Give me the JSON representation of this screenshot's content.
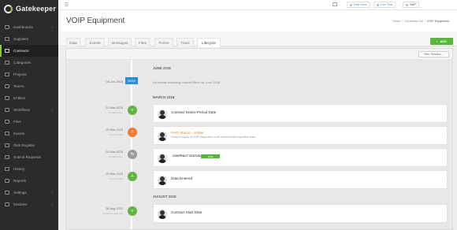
{
  "app": {
    "name": "Gatekeeper"
  },
  "sidebar": {
    "items": [
      {
        "label": "Dashboards",
        "arrow": true
      },
      {
        "label": "Suppliers",
        "arrow": false
      },
      {
        "label": "Contracts",
        "arrow": false,
        "active": true
      },
      {
        "label": "Categories",
        "arrow": false
      },
      {
        "label": "Projects",
        "arrow": false
      },
      {
        "label": "Teams",
        "arrow": false
      },
      {
        "label": "Entities",
        "arrow": false
      },
      {
        "label": "Workflows",
        "arrow": true
      },
      {
        "label": "Files",
        "arrow": false
      },
      {
        "label": "Events",
        "arrow": false
      },
      {
        "label": "Risk Register",
        "arrow": false
      },
      {
        "label": "Submit Requests",
        "arrow": false
      },
      {
        "label": "History",
        "arrow": false
      },
      {
        "label": "Reports",
        "arrow": false
      },
      {
        "label": "Settings",
        "arrow": true
      },
      {
        "label": "Modules",
        "arrow": true
      }
    ]
  },
  "topbar": {
    "help": "Help Docs",
    "chat": "Live Chat",
    "user": "SMP"
  },
  "page": {
    "title": "VOIP Equipment",
    "breadcrumb": [
      "Home",
      "Contracts List",
      "VOIP Equipment"
    ]
  },
  "tabs": [
    {
      "label": "Data"
    },
    {
      "label": "Events"
    },
    {
      "label": "Messages"
    },
    {
      "label": "Files"
    },
    {
      "label": "Forms"
    },
    {
      "label": "Track"
    },
    {
      "label": "Lifecycle",
      "active": true
    }
  ],
  "actions": {
    "add": "ADD",
    "filter": "Filter Timeline"
  },
  "timeline": {
    "months": [
      "JUNE 2018",
      "MARCH 2018",
      "AUGUST 2015"
    ],
    "now": {
      "date": "08-Jun-2018",
      "badge": "NOW",
      "message": "No events matching current filters for June 2018"
    },
    "events": [
      {
        "date": "22-Mar-2018",
        "ago": "2 months ago",
        "color": "#63b543",
        "title": "Contract Notice Period Date"
      },
      {
        "date": "09-Mar-2018",
        "ago": "3 months ago",
        "color": "#f07c3b",
        "title": "RAG Status - Amber",
        "subtitle": "Delay in supply of VOIP equipment, to be checked with respective team."
      },
      {
        "date": "09-Mar-2018",
        "ago": "3 months ago",
        "color": "#9a9a9a",
        "status_label": "CONTRACT STATUS:",
        "status_value": "LIVE",
        "status_color": "#5bb53d"
      },
      {
        "date": "09-Mar-2018",
        "ago": "3 months ago",
        "color": "#63b543",
        "title": "Data Entered"
      },
      {
        "date": "28-Aug-2015",
        "ago": "almost 3 years ago",
        "color": "#63b543",
        "title": "Contract Start Date"
      }
    ]
  }
}
